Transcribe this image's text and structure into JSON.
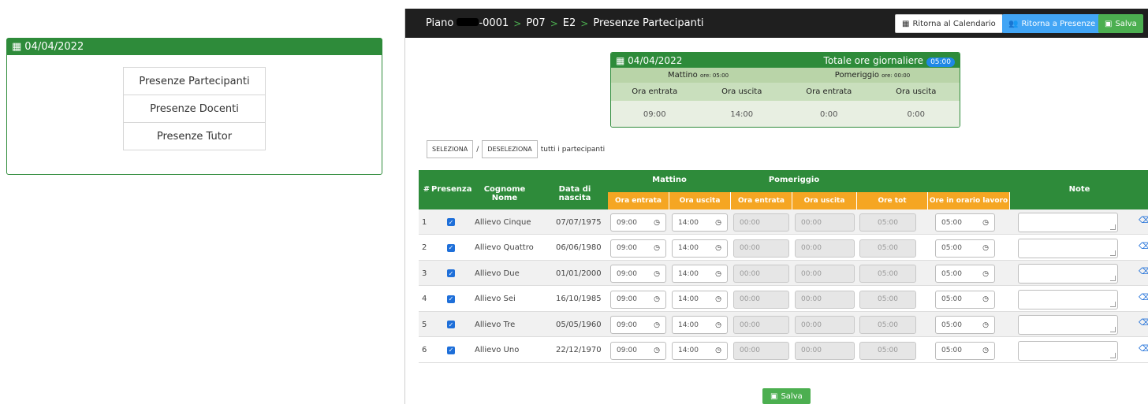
{
  "left_card": {
    "date": "04/04/2022",
    "menu": [
      "Presenze Partecipanti",
      "Presenze Docenti",
      "Presenze Tutor"
    ]
  },
  "breadcrumb": {
    "piano_prefix": "Piano",
    "piano_suffix": "-0001",
    "items": [
      "P07",
      "E2",
      "Presenze Partecipanti"
    ]
  },
  "toolbar": {
    "back_calendar": "Ritorna al Calendario",
    "back_presenze": "Ritorna a Presenze",
    "save": "Salva"
  },
  "day_summary": {
    "date": "04/04/2022",
    "total_label": "Totale ore giornaliere",
    "total_value": "05:00",
    "mattino_label": "Mattino",
    "mattino_ore": "ore: 05:00",
    "pomeriggio_label": "Pomeriggio",
    "pomeriggio_ore": "ore: 00:00",
    "col_labels": [
      "Ora entrata",
      "Ora uscita",
      "Ora entrata",
      "Ora uscita"
    ],
    "values": [
      "09:00",
      "14:00",
      "0:00",
      "0:00"
    ]
  },
  "selection": {
    "select_label": "SELEZIONA",
    "slash": "/",
    "deselect_label": "DESELEZIONA",
    "suffix": "tutti i partecipanti"
  },
  "table": {
    "headers": {
      "num": "#",
      "presenza": "Presenza",
      "name": "Cognome Nome",
      "birth": "Data di nascita",
      "mattino": "Mattino",
      "pomeriggio": "Pomeriggio",
      "note": "Note"
    },
    "sub_headers": [
      "Ora entrata",
      "Ora uscita",
      "Ora entrata",
      "Ora uscita",
      "Ore tot",
      "Ore in orario lavoro"
    ],
    "rows": [
      {
        "num": "1",
        "name": "Allievo Cinque",
        "birth": "07/07/1975",
        "m_in": "09:00",
        "m_out": "14:00",
        "p_in": "00:00",
        "p_out": "00:00",
        "tot": "05:00",
        "work": "05:00"
      },
      {
        "num": "2",
        "name": "Allievo Quattro",
        "birth": "06/06/1980",
        "m_in": "09:00",
        "m_out": "14:00",
        "p_in": "00:00",
        "p_out": "00:00",
        "tot": "05:00",
        "work": "05:00"
      },
      {
        "num": "3",
        "name": "Allievo Due",
        "birth": "01/01/2000",
        "m_in": "09:00",
        "m_out": "14:00",
        "p_in": "00:00",
        "p_out": "00:00",
        "tot": "05:00",
        "work": "05:00"
      },
      {
        "num": "4",
        "name": "Allievo Sei",
        "birth": "16/10/1985",
        "m_in": "09:00",
        "m_out": "14:00",
        "p_in": "00:00",
        "p_out": "00:00",
        "tot": "05:00",
        "work": "05:00"
      },
      {
        "num": "5",
        "name": "Allievo Tre",
        "birth": "05/05/1960",
        "m_in": "09:00",
        "m_out": "14:00",
        "p_in": "00:00",
        "p_out": "00:00",
        "tot": "05:00",
        "work": "05:00"
      },
      {
        "num": "6",
        "name": "Allievo Uno",
        "birth": "22/12/1970",
        "m_in": "09:00",
        "m_out": "14:00",
        "p_in": "00:00",
        "p_out": "00:00",
        "tot": "05:00",
        "work": "05:00"
      }
    ]
  },
  "footer": {
    "save": "Salva"
  },
  "colors": {
    "green": "#2e8b3a",
    "orange": "#f5a623",
    "blue": "#1e88e5",
    "dark": "#1f1f1f"
  },
  "icons": {
    "calendar": "calendar-icon",
    "save": "floppy-icon",
    "clock": "clock-icon",
    "eraser": "eraser-icon"
  }
}
